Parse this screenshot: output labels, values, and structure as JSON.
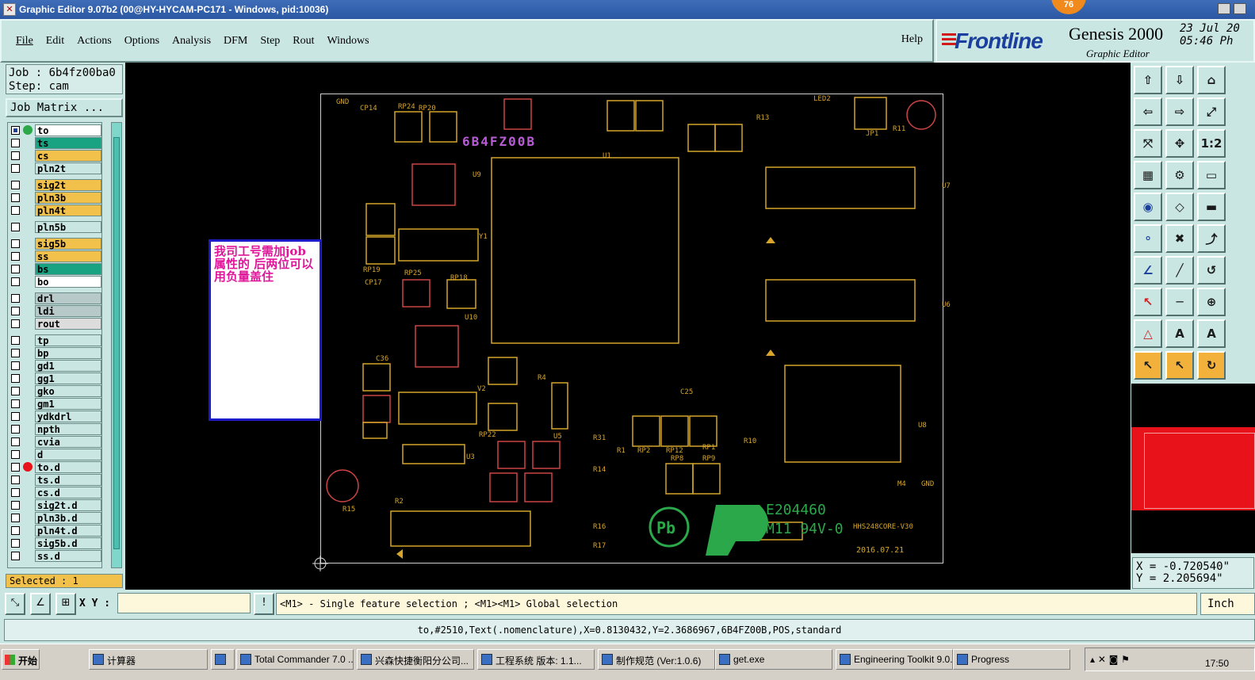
{
  "window": {
    "title": "Graphic Editor 9.07b2 (00@HY-HYCAM-PC171 - Windows, pid:10036)",
    "badge": "76"
  },
  "menu": {
    "items": [
      "File",
      "Edit",
      "Actions",
      "Options",
      "Analysis",
      "DFM",
      "Step",
      "Rout",
      "Windows"
    ],
    "help": "Help"
  },
  "logo": {
    "brand": "Frontline",
    "product": "Genesis 2000",
    "subtitle": "Graphic Editor",
    "date": "23 Jul 20",
    "time": "05:46 Ph"
  },
  "job": {
    "job_line": "Job : 6b4fz00ba0",
    "step_line": "Step: cam",
    "matrix_button": "Job Matrix ..."
  },
  "layers": [
    {
      "name": "to",
      "color": "#ffffff",
      "checked": true,
      "marker": "#2aa84a"
    },
    {
      "name": "ts",
      "color": "#19a383",
      "checked": false,
      "marker": ""
    },
    {
      "name": "cs",
      "color": "#f2c14b",
      "checked": false,
      "marker": ""
    },
    {
      "name": "pln2t",
      "color": "#c9e6e3",
      "checked": false,
      "marker": ""
    },
    {
      "name": "sig2t",
      "color": "#f2c14b",
      "checked": false,
      "marker": ""
    },
    {
      "name": "pln3b",
      "color": "#f2c14b",
      "checked": false,
      "marker": ""
    },
    {
      "name": "pln4t",
      "color": "#f2c14b",
      "checked": false,
      "marker": ""
    },
    {
      "name": "pln5b",
      "color": "#c9e6e3",
      "checked": false,
      "marker": ""
    },
    {
      "name": "sig5b",
      "color": "#f2c14b",
      "checked": false,
      "marker": ""
    },
    {
      "name": "ss",
      "color": "#f2c14b",
      "checked": false,
      "marker": ""
    },
    {
      "name": "bs",
      "color": "#19a383",
      "checked": false,
      "marker": ""
    },
    {
      "name": "bo",
      "color": "#ffffff",
      "checked": false,
      "marker": ""
    },
    {
      "name": "drl",
      "color": "#b7c9c8",
      "checked": false,
      "marker": ""
    },
    {
      "name": "ldi",
      "color": "#b7c9c8",
      "checked": false,
      "marker": ""
    },
    {
      "name": "rout",
      "color": "#dcdcdc",
      "checked": false,
      "marker": ""
    },
    {
      "name": "tp",
      "color": "#c9e6e3",
      "checked": false,
      "marker": ""
    },
    {
      "name": "bp",
      "color": "#c9e6e3",
      "checked": false,
      "marker": ""
    },
    {
      "name": "gd1",
      "color": "#c9e6e3",
      "checked": false,
      "marker": ""
    },
    {
      "name": "gg1",
      "color": "#c9e6e3",
      "checked": false,
      "marker": ""
    },
    {
      "name": "gko",
      "color": "#c9e6e3",
      "checked": false,
      "marker": ""
    },
    {
      "name": "gm1",
      "color": "#c9e6e3",
      "checked": false,
      "marker": ""
    },
    {
      "name": "ydkdrl",
      "color": "#c9e6e3",
      "checked": false,
      "marker": ""
    },
    {
      "name": "npth",
      "color": "#c9e6e3",
      "checked": false,
      "marker": ""
    },
    {
      "name": "cvia",
      "color": "#c9e6e3",
      "checked": false,
      "marker": ""
    },
    {
      "name": "d",
      "color": "#c9e6e3",
      "checked": false,
      "marker": ""
    },
    {
      "name": "to.d",
      "color": "#c9e6e3",
      "checked": false,
      "marker": "#e8121a"
    },
    {
      "name": "ts.d",
      "color": "#c9e6e3",
      "checked": false,
      "marker": ""
    },
    {
      "name": "cs.d",
      "color": "#c9e6e3",
      "checked": false,
      "marker": ""
    },
    {
      "name": "sig2t.d",
      "color": "#c9e6e3",
      "checked": false,
      "marker": ""
    },
    {
      "name": "pln3b.d",
      "color": "#c9e6e3",
      "checked": false,
      "marker": ""
    },
    {
      "name": "pln4t.d",
      "color": "#c9e6e3",
      "checked": false,
      "marker": ""
    },
    {
      "name": "sig5b.d",
      "color": "#c9e6e3",
      "checked": false,
      "marker": ""
    },
    {
      "name": "ss.d",
      "color": "#c9e6e3",
      "checked": false,
      "marker": ""
    }
  ],
  "selected": "Selected : 1",
  "canvas": {
    "job_text": "6B4FZ00B",
    "note": "我司工号需加job属性的  后两位可以用负量盖住",
    "labels": [
      "GND",
      "CP14",
      "RP24",
      "RP20",
      "RP17",
      "RP15",
      "RP16",
      "RP5",
      "RP11",
      "R13",
      "LED2",
      "R12",
      "JP1",
      "R11",
      "R32",
      "U1",
      "U9",
      "C31",
      "CP12",
      "RP26",
      "Y1",
      "RP19",
      "RP25",
      "RP18",
      "U10",
      "CP17",
      "C33",
      "CP15",
      "C36",
      "RP27",
      "U7",
      "C19",
      "C51",
      "U6",
      "C28",
      "C25",
      "C23",
      "R10",
      "U8",
      "RP21",
      "R29",
      "U4",
      "U3",
      "RP22",
      "U5",
      "R4",
      "R3",
      "RP13",
      "RP14",
      "R31",
      "R1",
      "RP2",
      "RP12",
      "RP1",
      "RP8",
      "RP9",
      "C5",
      "RP6",
      "RP7",
      "LED1",
      "R2",
      "R15",
      "C21",
      "R14",
      "R16",
      "R17",
      "M4",
      "GND",
      "E204460",
      "M11 94V-0",
      "HHS248CORE-V30",
      "2016.07.21",
      "Pb",
      "M"
    ]
  },
  "coords": {
    "x": "X = -0.720540\"",
    "y": "Y = 2.205694\""
  },
  "status": {
    "xy_label": "X Y :",
    "xy_value": "",
    "hint": "<M1> - Single feature selection ; <M1><M1> Global selection",
    "unit": "Inch",
    "info": "to,#2510,Text(.nomenclature),X=0.8130432,Y=2.3686967,6B4FZ00B,POS,standard"
  },
  "taskbar": {
    "start": "开始",
    "tasks": [
      "计算器",
      "",
      "Total Commander 7.0 ...",
      "兴森快捷衡阳分公司...",
      "工程系统  版本: 1.1...",
      "制作规范 (Ver:1.0.6)",
      "get.exe",
      "Engineering Toolkit 9.0...",
      "Progress"
    ],
    "clock": "17:50"
  },
  "colors": {
    "panel": "#c9e6e3",
    "pcb_line": "#d6a52a",
    "highlight": "#f2c14b",
    "job_text": "#b85cd6",
    "note_text": "#e0169a",
    "ul_logo": "#2aa84a"
  },
  "icons": {
    "tools": [
      "move-up-icon",
      "move-down-icon",
      "home-icon",
      "move-left-icon",
      "move-right-icon",
      "scale-icon",
      "zoom-fit-icon",
      "pan-icon",
      "ratio-icon",
      "grid-icon",
      "snap-icon",
      "measure-icon",
      "pad-icon",
      "polygon-icon",
      "ruler-icon",
      "connect-icon",
      "delete-feature-icon",
      "split-icon",
      "line-icon",
      "slash-icon",
      "arc-icon",
      "select-icon",
      "minus-icon",
      "move-feature-icon",
      "triangle-icon",
      "text-a-icon",
      "a-outline-icon",
      "pointer-icon",
      "pointer-alt-icon",
      "rotate-icon"
    ]
  }
}
